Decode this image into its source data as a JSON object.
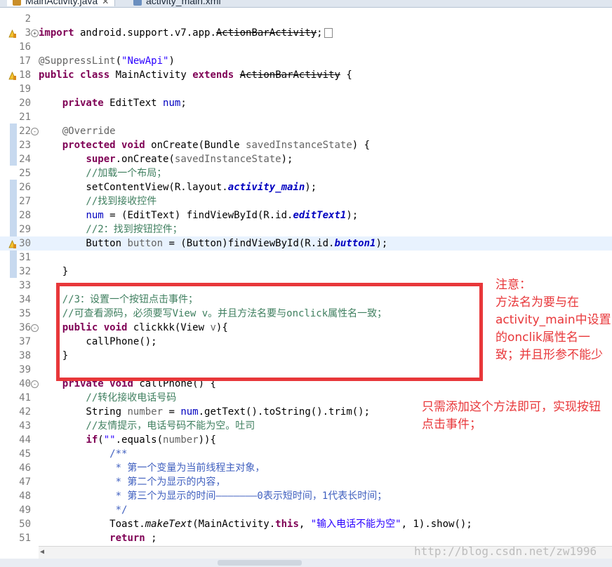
{
  "tabs": [
    {
      "label": "MainActivity.java",
      "close": "✕"
    },
    {
      "label": "activity_main.xml"
    }
  ],
  "lines": [
    {
      "n": "2",
      "t": ""
    },
    {
      "n": "3",
      "t": "import android.support.v7.app.ActionBarActivity;"
    },
    {
      "n": "16",
      "t": ""
    },
    {
      "n": "17",
      "t": "@SuppressLint(\"NewApi\")"
    },
    {
      "n": "18",
      "t": "public class MainActivity extends ActionBarActivity {"
    },
    {
      "n": "19",
      "t": ""
    },
    {
      "n": "20",
      "t": "    private EditText num;"
    },
    {
      "n": "21",
      "t": ""
    },
    {
      "n": "22",
      "t": "    @Override"
    },
    {
      "n": "23",
      "t": "    protected void onCreate(Bundle savedInstanceState) {"
    },
    {
      "n": "24",
      "t": "        super.onCreate(savedInstanceState);"
    },
    {
      "n": "25",
      "t": "        //加载一个布局；"
    },
    {
      "n": "26",
      "t": "        setContentView(R.layout.activity_main);"
    },
    {
      "n": "27",
      "t": "        //找到接收控件"
    },
    {
      "n": "28",
      "t": "        num = (EditText) findViewById(R.id.editText1);"
    },
    {
      "n": "29",
      "t": "        //2：找到按钮控件；"
    },
    {
      "n": "30",
      "t": "        Button button = (Button)findViewById(R.id.button1);"
    },
    {
      "n": "31",
      "t": ""
    },
    {
      "n": "32",
      "t": "    }"
    },
    {
      "n": "33",
      "t": ""
    },
    {
      "n": "34",
      "t": "    //3：设置一个按钮点击事件；"
    },
    {
      "n": "35",
      "t": "    //可查看源码，必须要写View v。并且方法名要与onclick属性名一致；"
    },
    {
      "n": "36",
      "t": "    public void clickkk(View v){"
    },
    {
      "n": "37",
      "t": "        callPhone();"
    },
    {
      "n": "38",
      "t": "    }"
    },
    {
      "n": "39",
      "t": ""
    },
    {
      "n": "40",
      "t": "    private void callPhone() {"
    },
    {
      "n": "41",
      "t": "        //转化接收电话号码"
    },
    {
      "n": "42",
      "t": "        String number = num.getText().toString().trim();"
    },
    {
      "n": "43",
      "t": "        //友情提示，电话号码不能为空。吐司"
    },
    {
      "n": "44",
      "t": "        if(\"\".equals(number)){"
    },
    {
      "n": "45",
      "t": "            /**"
    },
    {
      "n": "46",
      "t": "             * 第一个变量为当前线程主对象，"
    },
    {
      "n": "47",
      "t": "             * 第二个为显示的内容，"
    },
    {
      "n": "48",
      "t": "             * 第三个为显示的时间———————0表示短时间，1代表长时间；"
    },
    {
      "n": "49",
      "t": "             */"
    },
    {
      "n": "50",
      "t": "            Toast.makeText(MainActivity.this, \"输入电话不能为空\", 1).show();"
    },
    {
      "n": "51",
      "t": "            return ;"
    }
  ],
  "annotations": {
    "note1": "注意：\n方法名为要与在activity_main中设置的onclik属性名一致；并且形参不能少",
    "note2": "只需添加这个方法即可，实现按钮点击事件；"
  },
  "watermark": "http://blog.csdn.net/zw1996",
  "colors": {
    "highlight_box": "#e8373a",
    "keyword": "#7f0055",
    "comment": "#3f7f5f",
    "string": "#2a00ff"
  }
}
